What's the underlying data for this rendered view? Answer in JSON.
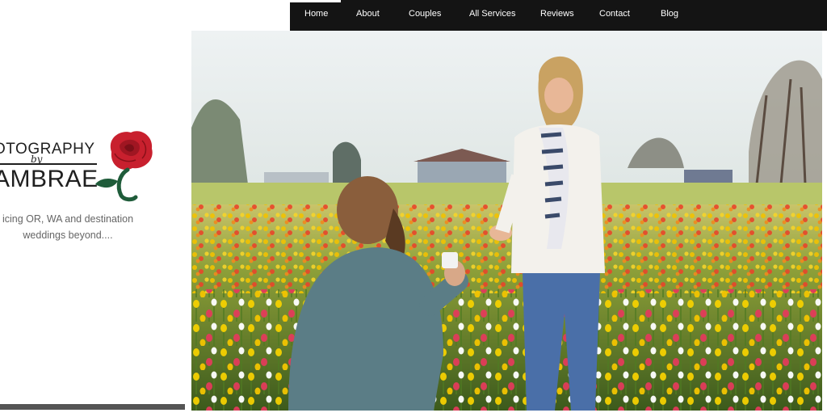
{
  "logo": {
    "line1": "OTOGRAPHY",
    "by": "by",
    "line2": "AMBRAE"
  },
  "tagline": {
    "line1": "icing OR, WA and destination",
    "line2": "weddings beyond...."
  },
  "nav": {
    "items": [
      {
        "label": "Home",
        "active": true
      },
      {
        "label": "About"
      },
      {
        "label": "Couples"
      },
      {
        "label": "All Services"
      },
      {
        "label": "Reviews"
      },
      {
        "label": "Contact"
      },
      {
        "label": "Blog"
      }
    ]
  },
  "hero": {
    "subject": "proposal-in-tulip-field"
  },
  "colors": {
    "nav_bg": "#141414",
    "rose": "#c8202e",
    "leaf": "#1f5c3a",
    "text": "#1f1f1f"
  }
}
